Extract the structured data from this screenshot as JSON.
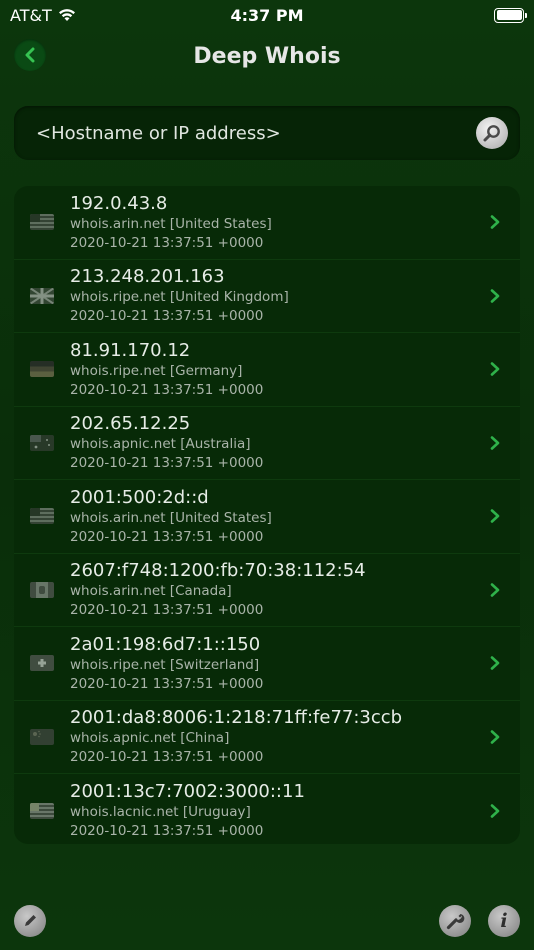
{
  "status": {
    "carrier": "AT&T",
    "time": "4:37 PM"
  },
  "nav": {
    "title": "Deep Whois",
    "back_icon": "chevron-left-icon"
  },
  "search": {
    "placeholder": "<Hostname or IP address>",
    "value": ""
  },
  "colors": {
    "accent": "#2fb14a",
    "background": "#0c320c"
  },
  "rows": [
    {
      "ip": "192.0.43.8",
      "server": "whois.arin.net [United States]",
      "date": "2020-10-21 13:37:51 +0000",
      "flag": "flag-us-icon"
    },
    {
      "ip": "213.248.201.163",
      "server": "whois.ripe.net [United Kingdom]",
      "date": "2020-10-21 13:37:51 +0000",
      "flag": "flag-uk-icon"
    },
    {
      "ip": "81.91.170.12",
      "server": "whois.ripe.net [Germany]",
      "date": "2020-10-21 13:37:51 +0000",
      "flag": "flag-de-icon"
    },
    {
      "ip": "202.65.12.25",
      "server": "whois.apnic.net [Australia]",
      "date": "2020-10-21 13:37:51 +0000",
      "flag": "flag-au-icon"
    },
    {
      "ip": "2001:500:2d::d",
      "server": "whois.arin.net [United States]",
      "date": "2020-10-21 13:37:51 +0000",
      "flag": "flag-us-icon"
    },
    {
      "ip": "2607:f748:1200:fb:70:38:112:54",
      "server": "whois.arin.net [Canada]",
      "date": "2020-10-21 13:37:51 +0000",
      "flag": "flag-ca-icon"
    },
    {
      "ip": "2a01:198:6d7:1::150",
      "server": "whois.ripe.net [Switzerland]",
      "date": "2020-10-21 13:37:51 +0000",
      "flag": "flag-ch-icon"
    },
    {
      "ip": "2001:da8:8006:1:218:71ff:fe77:3ccb",
      "server": "whois.apnic.net [China]",
      "date": "2020-10-21 13:37:51 +0000",
      "flag": "flag-cn-icon"
    },
    {
      "ip": "2001:13c7:7002:3000::11",
      "server": "whois.lacnic.net [Uruguay]",
      "date": "2020-10-21 13:37:51 +0000",
      "flag": "flag-uy-icon"
    }
  ],
  "toolbar": {
    "edit_icon": "pencil-icon",
    "tools_icon": "wrench-icon",
    "info_icon": "info-icon",
    "info_label": "i"
  }
}
